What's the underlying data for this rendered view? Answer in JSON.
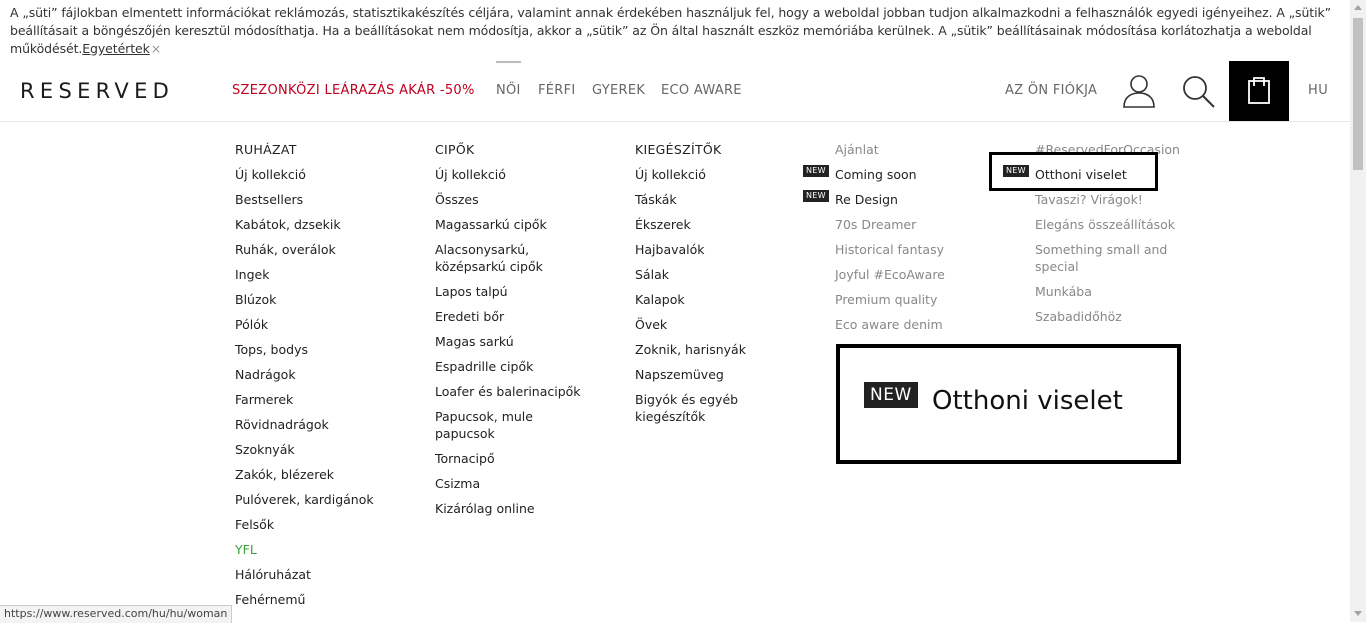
{
  "cookie": {
    "line1": "A „süti” fájlokban elmentett információkat reklámozás, statisztikakészítés céljára, valamint annak érdekében használjuk fel, hogy a weboldal jobban tudjon alkalmazkodni a felhasználók egyedi igényeihez. A „sütik”",
    "line2": "beállításait a böngészőjén keresztül módosíthatja. Ha a beállításokat nem módosítja, akkor a „sütik” az Ön által használt eszköz memóriába kerülnek. A „sütik” beállításainak módosítása korlátozhatja a weboldal",
    "line3": "működését.",
    "accept_label": "Egyetértek",
    "close_glyph": "×"
  },
  "header": {
    "logo": "RESERVED",
    "nav": {
      "sale": "SZEZONKÖZI LEÁRAZÁS AKÁR -50%",
      "women": "NŐI",
      "men": "FÉRFI",
      "kids": "GYEREK",
      "eco": "ECO AWARE"
    },
    "account_label": "AZ ÖN FIÓKJA",
    "lang": "HU",
    "icons": {
      "user": "user-icon",
      "search": "search-icon",
      "cart": "shopping-bag-icon"
    }
  },
  "menu": {
    "clothing": {
      "title": "RUHÁZAT",
      "items": [
        "Új kollekció",
        "Bestsellers",
        "Kabátok, dzsekik",
        "Ruhák, overálok",
        "Ingek",
        "Blúzok",
        "Pólók",
        "Tops, bodys",
        "Nadrágok",
        "Farmerek",
        "Rövidnadrágok",
        "Szoknyák",
        "Zakók, blézerek",
        "Pulóverek, kardigánok",
        "Felsők",
        "YFL",
        "Hálóruházat",
        "Fehérnemű"
      ]
    },
    "shoes": {
      "title": "CIPŐK",
      "items": [
        "Új kollekció",
        "Összes",
        "Magassarkú cipők",
        "Alacsonysarkú, középsarkú cipők",
        "Lapos talpú",
        "Eredeti bőr",
        "Magas sarkú",
        "Espadrille cipők",
        "Loafer és balerinacipők",
        "Papucsok, mule papucsok",
        "Tornacipő",
        "Csizma",
        "Kizárólag online"
      ]
    },
    "accessories": {
      "title": "KIEGÉSZÍTŐK",
      "items": [
        "Új kollekció",
        "Táskák",
        "Ékszerek",
        "Hajbavalók",
        "Sálak",
        "Kalapok",
        "Övek",
        "Zoknik, harisnyák",
        "Napszemüveg",
        "Bigyók és egyéb kiegészítők"
      ]
    },
    "offers": {
      "items": [
        "Ajánlat",
        "Coming soon",
        "Re Design",
        "70s Dreamer",
        "Historical fantasy",
        "Joyful #EcoAware",
        "Premium quality",
        "Eco aware denim"
      ],
      "new_badge": "NEW"
    },
    "occasion": {
      "items": [
        "#ReservedForOccasion",
        "Otthoni viselet",
        "Tavaszi? Virágok!",
        "Elegáns összeállítások",
        "Something small and special",
        "Munkába",
        "Szabadidőhöz"
      ],
      "new_badge": "NEW"
    }
  },
  "zoom": {
    "badge": "NEW",
    "label": "Otthoni viselet"
  },
  "status_url": "https://www.reserved.com/hu/hu/woman"
}
